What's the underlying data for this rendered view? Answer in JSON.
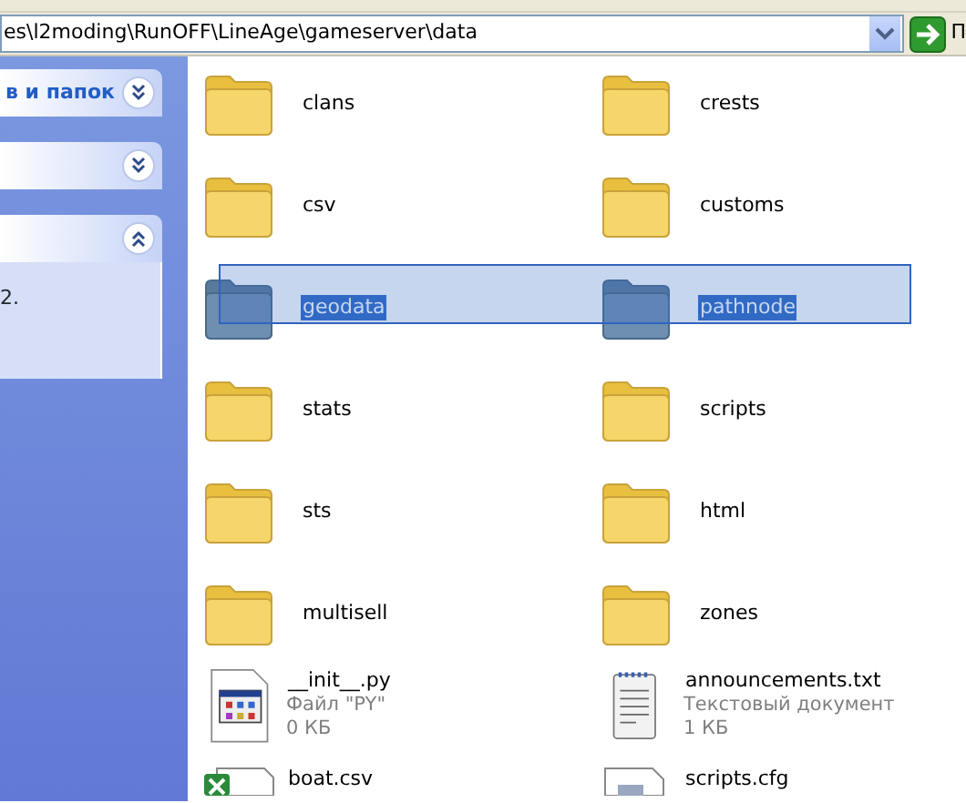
{
  "address_bar": {
    "value": "es\\l2moding\\RunOFF\\LineAge\\gameserver\\data",
    "go_label": "П"
  },
  "task_panels": [
    {
      "title": "в и папок",
      "expanded": false
    },
    {
      "expanded": false
    },
    {
      "expanded": true,
      "body": "2."
    }
  ],
  "items": [
    {
      "name": "clans",
      "kind": "folder",
      "selected": false
    },
    {
      "name": "crests",
      "kind": "folder",
      "selected": false
    },
    {
      "name": "csv",
      "kind": "folder",
      "selected": false
    },
    {
      "name": "customs",
      "kind": "folder",
      "selected": false
    },
    {
      "name": "geodata",
      "kind": "folder",
      "selected": true
    },
    {
      "name": "pathnode",
      "kind": "folder",
      "selected": true
    },
    {
      "name": "stats",
      "kind": "folder",
      "selected": false
    },
    {
      "name": "scripts",
      "kind": "folder",
      "selected": false
    },
    {
      "name": "sts",
      "kind": "folder",
      "selected": false
    },
    {
      "name": "html",
      "kind": "folder",
      "selected": false
    },
    {
      "name": "multisell",
      "kind": "folder",
      "selected": false
    },
    {
      "name": "zones",
      "kind": "folder",
      "selected": false
    },
    {
      "name": "__init__.py",
      "kind": "app",
      "selected": false,
      "type_label": "Файл \"PY\"",
      "size": "0 КБ"
    },
    {
      "name": "announcements.txt",
      "kind": "text",
      "selected": false,
      "type_label": "Текстовый документ",
      "size": "1 КБ"
    },
    {
      "name": "boat.csv",
      "kind": "sheet",
      "selected": false
    },
    {
      "name": "scripts.cfg",
      "kind": "doc",
      "selected": false
    }
  ]
}
